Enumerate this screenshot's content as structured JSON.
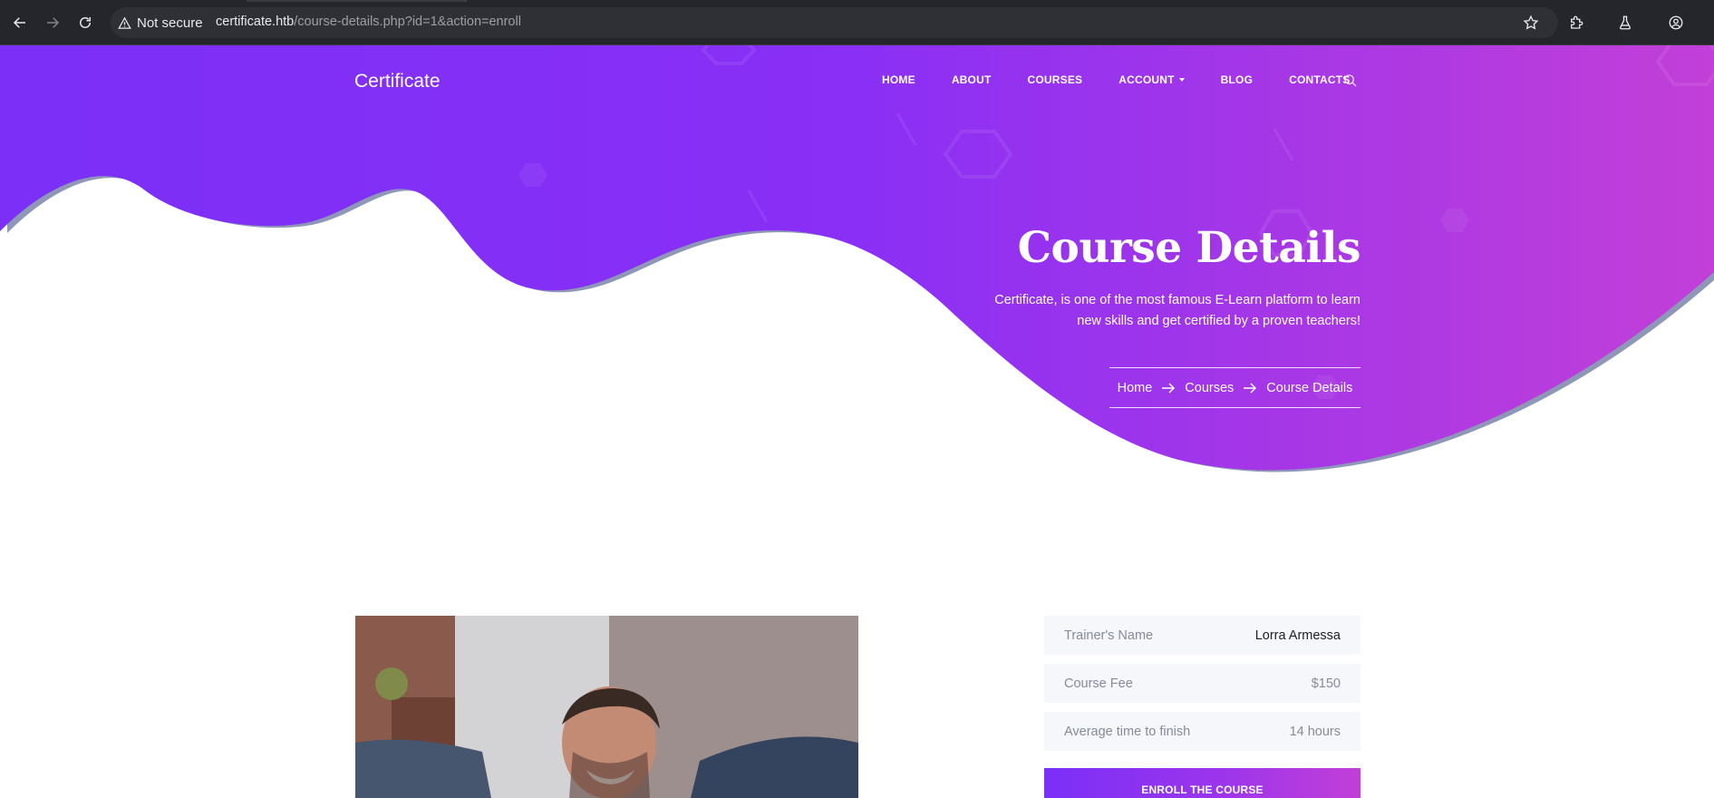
{
  "browser": {
    "security_label": "Not secure",
    "url_host": "certificate.htb",
    "url_path": "/course-details.php?id=1&action=enroll"
  },
  "colors": {
    "hero_gradient_start": "#7b2ff7",
    "hero_gradient_end": "#c23fd8",
    "wave_shadow": "#8e97b8",
    "info_row_bg": "#f6f7fa"
  },
  "header": {
    "brand": "Certificate",
    "nav": [
      {
        "label": "HOME"
      },
      {
        "label": "ABOUT"
      },
      {
        "label": "COURSES"
      },
      {
        "label": "ACCOUNT",
        "has_dropdown": true
      },
      {
        "label": "BLOG"
      },
      {
        "label": "CONTACTS"
      }
    ],
    "search_icon": "search-icon"
  },
  "hero": {
    "title": "Course Details",
    "description": "Certificate, is one of the most famous E-Learn platform to learn new skills and get certified by a proven teachers!",
    "breadcrumb": [
      "Home",
      "Courses",
      "Course Details"
    ]
  },
  "course": {
    "details": [
      {
        "label": "Trainer's Name",
        "value": "Lorra Armessa"
      },
      {
        "label": "Course Fee",
        "value": "$150"
      },
      {
        "label": "Average time to finish",
        "value": "14 hours"
      }
    ],
    "enroll_label": "ENROLL THE COURSE"
  }
}
